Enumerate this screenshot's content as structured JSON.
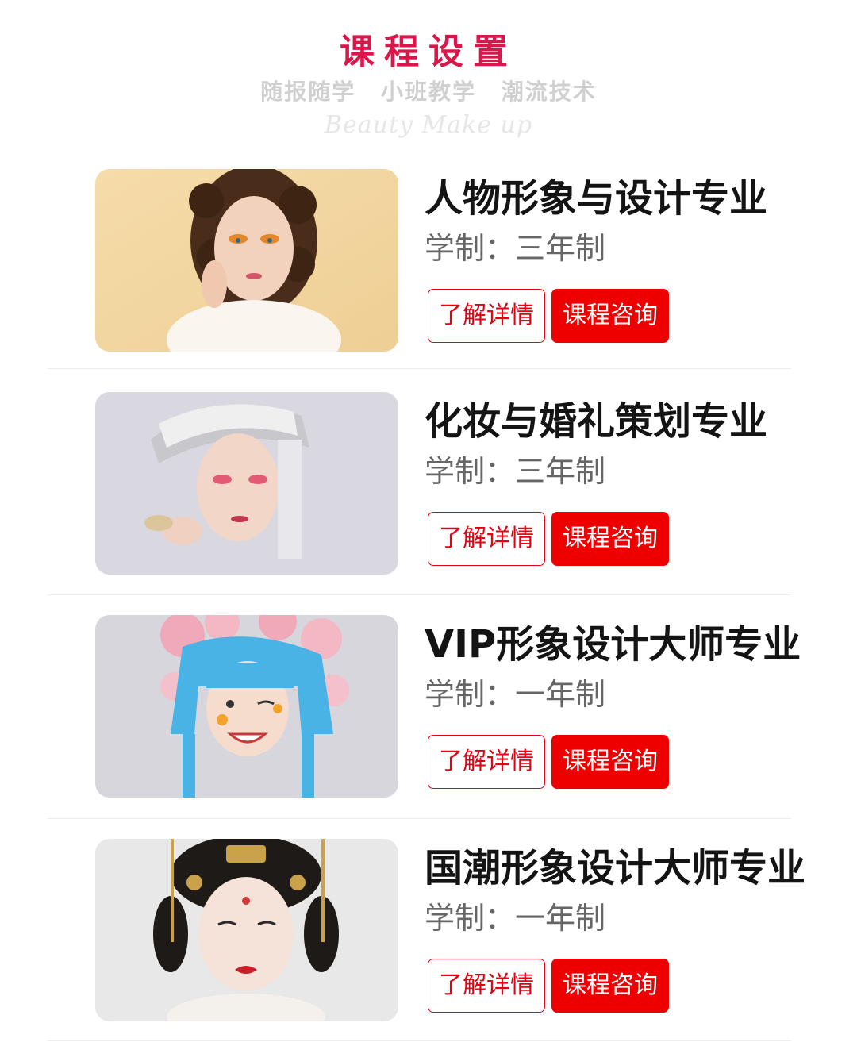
{
  "header": {
    "title": "课程设置",
    "tagline_1": "随报随学",
    "tagline_2": "小班教学",
    "tagline_3": "潮流技术",
    "script_text": "Beauty Make up"
  },
  "courses": [
    {
      "name": "人物形象与设计专业",
      "duration": "学制：三年制",
      "detail_label": "了解详情",
      "consult_label": "课程咨询"
    },
    {
      "name": "化妆与婚礼策划专业",
      "duration": "学制：三年制",
      "detail_label": "了解详情",
      "consult_label": "课程咨询"
    },
    {
      "name": "VIP形象设计大师专业",
      "duration": "学制：一年制",
      "detail_label": "了解详情",
      "consult_label": "课程咨询"
    },
    {
      "name": "国潮形象设计大师专业",
      "duration": "学制：一年制",
      "detail_label": "了解详情",
      "consult_label": "课程咨询"
    }
  ],
  "colors": {
    "accent": "#d9174b",
    "button_red": "#ee0000",
    "tagline_gray": "#d0d0d0"
  }
}
